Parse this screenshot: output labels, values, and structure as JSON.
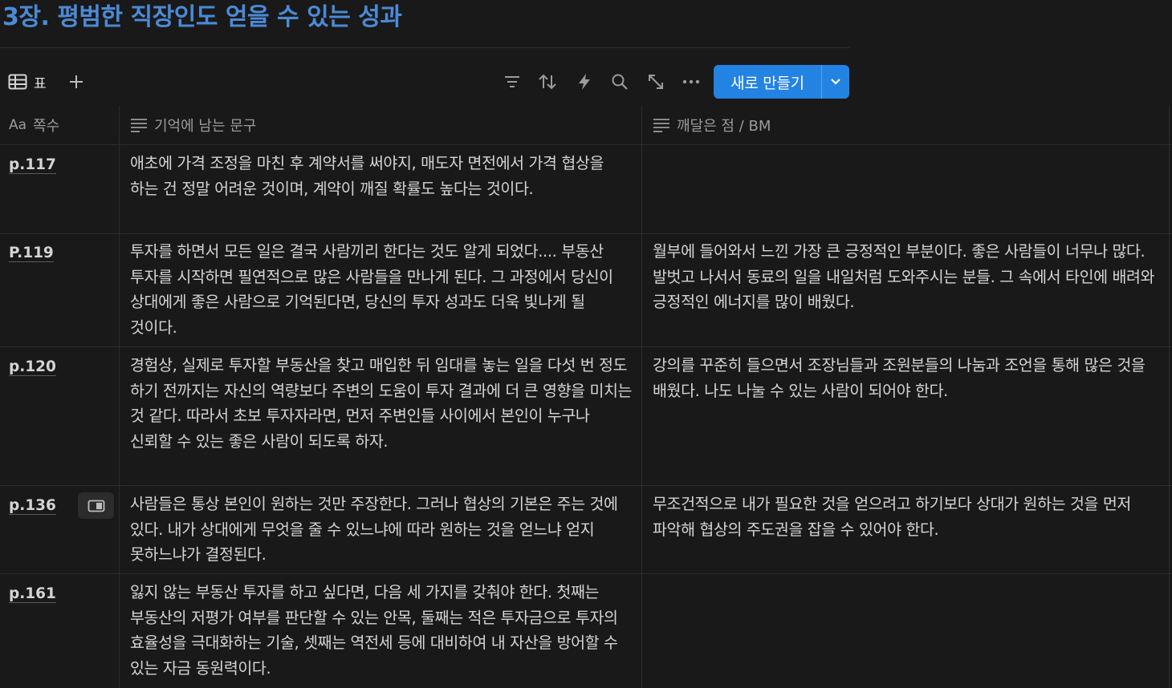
{
  "page": {
    "title": "3장. 평범한 직장인도 얻을 수 있는 성과"
  },
  "toolbar": {
    "view_label": "표",
    "new_button_label": "새로 만들기",
    "icons": [
      "table-icon",
      "plus-icon",
      "filter-icon",
      "sort-icon",
      "automation-icon",
      "search-icon",
      "expand-icon",
      "more-icon",
      "chevron-down-icon"
    ]
  },
  "table": {
    "columns": [
      {
        "prefix": "Aa",
        "label": "쪽수"
      },
      {
        "label": "기억에 남는 문구"
      },
      {
        "label": "깨달은 점 / BM"
      }
    ],
    "rows": [
      {
        "page": "p.117",
        "quote": "애초에 가격 조정을 마친 후 계약서를 써야지, 매도자 면전에서 가격 협상을 하는 건 정말 어려운 것이며, 계약이 깨질 확률도 높다는 것이다.",
        "insight": ""
      },
      {
        "page": "P.119",
        "quote": "투자를 하면서 모든 일은 결국 사람끼리 한다는 것도 알게 되었다.... 부동산 투자를 시작하면 필연적으로 많은 사람들을 만나게 된다. 그 과정에서 당신이 상대에게 좋은 사람으로 기억된다면, 당신의 투자 성과도 더욱 빛나게 될 것이다.",
        "insight": "월부에 들어와서 느낀 가장 큰 긍정적인 부분이다. 좋은 사람들이 너무나 많다. 발벗고 나서서 동료의 일을 내일처럼 도와주시는 분들. 그 속에서 타인에 배려와 긍정적인 에너지를 많이 배웠다."
      },
      {
        "page": "p.120",
        "quote": "경험상, 실제로 투자할 부동산을 찾고 매입한 뒤 임대를 놓는 일을 다섯 번 정도 하기 전까지는 자신의 역량보다 주변의 도움이 투자 결과에 더 큰 영향을 미치는 것 같다. 따라서 초보 투자자라면, 먼저 주변인들 사이에서 본인이 누구나 신뢰할 수 있는 좋은 사람이 되도록 하자.",
        "insight": "강의를 꾸준히 들으면서 조장님들과 조원분들의 나눔과 조언을 통해 많은 것을 배웠다. 나도 나눌 수 있는 사람이 되어야 한다."
      },
      {
        "page": "p.136",
        "quote": "사람들은 통상 본인이 원하는 것만 주장한다. 그러나 협상의 기본은 주는 것에 있다. 내가 상대에게 무엇을 줄 수 있느냐에 따라 원하는 것을 얻느냐 얻지 못하느냐가 결정된다.",
        "insight": "무조건적으로 내가 필요한 것을 얻으려고 하기보다 상대가 원하는 것을 먼저 파악해 협상의 주도권을 잡을 수 있어야 한다."
      },
      {
        "page": "p.161",
        "quote": "잃지 않는 부동산 투자를 하고 싶다면, 다음 세 가지를 갖춰야 한다. 첫째는 부동산의 저평가 여부를 판단할 수 있는 안목, 둘째는 적은 투자금으로 투자의 효율성을 극대화하는 기술, 셋째는 역전세 등에 대비하여 내 자산을 방어할 수 있는 자금 동원력이다.",
        "insight": ""
      }
    ]
  }
}
